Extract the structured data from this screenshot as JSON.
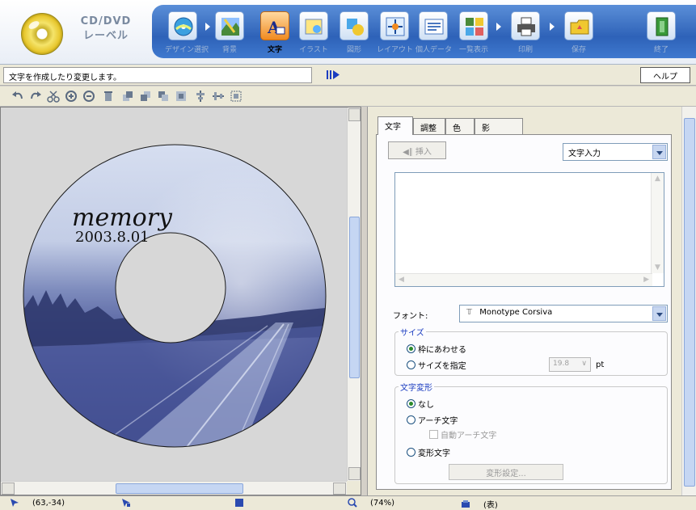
{
  "app": {
    "logo_line1": "CD/DVD",
    "logo_line2": "レーベル"
  },
  "toolbar": {
    "tools": [
      {
        "label": "デザイン選択",
        "icon": "disc-design-icon"
      },
      {
        "label": "背景",
        "icon": "background-icon"
      },
      {
        "label": "文字",
        "icon": "text-icon",
        "active": true
      },
      {
        "label": "イラスト",
        "icon": "illustration-icon"
      },
      {
        "label": "図形",
        "icon": "shape-icon"
      },
      {
        "label": "レイアウト",
        "icon": "layout-icon"
      },
      {
        "label": "個人データ",
        "icon": "personal-data-icon"
      },
      {
        "label": "一覧表示",
        "icon": "list-view-icon"
      },
      {
        "label": "印刷",
        "icon": "printer-icon"
      },
      {
        "label": "保存",
        "icon": "save-folder-icon"
      },
      {
        "label": "終了",
        "icon": "exit-door-icon"
      }
    ]
  },
  "infobar": {
    "status": "文字を作成したり変更します。",
    "help_label": "ヘルプ"
  },
  "preview": {
    "title_text": "memory",
    "date_text": "2003.8.01"
  },
  "panel": {
    "tabs": [
      "文字",
      "調整",
      "色",
      "影"
    ],
    "insert_label": "◀∥ 挿入",
    "mode_value": "文字入力",
    "font_label": "フォント:",
    "font_value": "Monotype Corsiva",
    "size_group": {
      "legend": "サイズ",
      "fit_frame": "枠にあわせる",
      "specify_size": "サイズを指定",
      "size_value": "19.8",
      "unit": "pt"
    },
    "deform_group": {
      "legend": "文字変形",
      "none": "なし",
      "arch_text": "アーチ文字",
      "auto_arch": "自動アーチ文字",
      "deform_text": "変形文字",
      "settings_button": "変形設定..."
    }
  },
  "statusbar": {
    "coords": "(63,-34)",
    "zoom": "(74%)",
    "side": "(表)"
  },
  "colors": {
    "toolbar_blue": "#2e62b8",
    "active_tool": "#f08a20",
    "legend_blue": "#1a3cc0"
  }
}
